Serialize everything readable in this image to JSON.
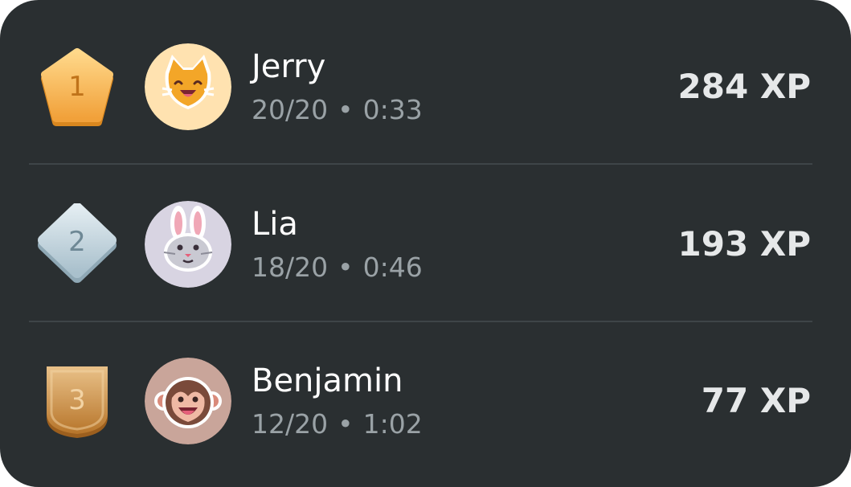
{
  "leaderboard": {
    "entries": [
      {
        "rank": "1",
        "badge": "gold-pentagon-badge",
        "avatar": "cat-face-icon",
        "name": "Jerry",
        "score": "20/20",
        "separator": "•",
        "time": "0:33",
        "xp": "284 XP"
      },
      {
        "rank": "2",
        "badge": "silver-diamond-badge",
        "avatar": "rabbit-face-icon",
        "name": "Lia",
        "score": "18/20",
        "separator": "•",
        "time": "0:46",
        "xp": "193 XP"
      },
      {
        "rank": "3",
        "badge": "bronze-shield-badge",
        "avatar": "monkey-face-icon",
        "name": "Benjamin",
        "score": "12/20",
        "separator": "•",
        "time": "1:02",
        "xp": "77 XP"
      }
    ]
  },
  "colors": {
    "card_background": "#2a2f31",
    "divider": "#3e4548",
    "name_text": "#ffffff",
    "meta_text": "#9aa2a6",
    "xp_text": "#e6e8e9",
    "gold": "#f0a93b",
    "silver": "#b9ccd6",
    "bronze": "#c98b3d"
  }
}
